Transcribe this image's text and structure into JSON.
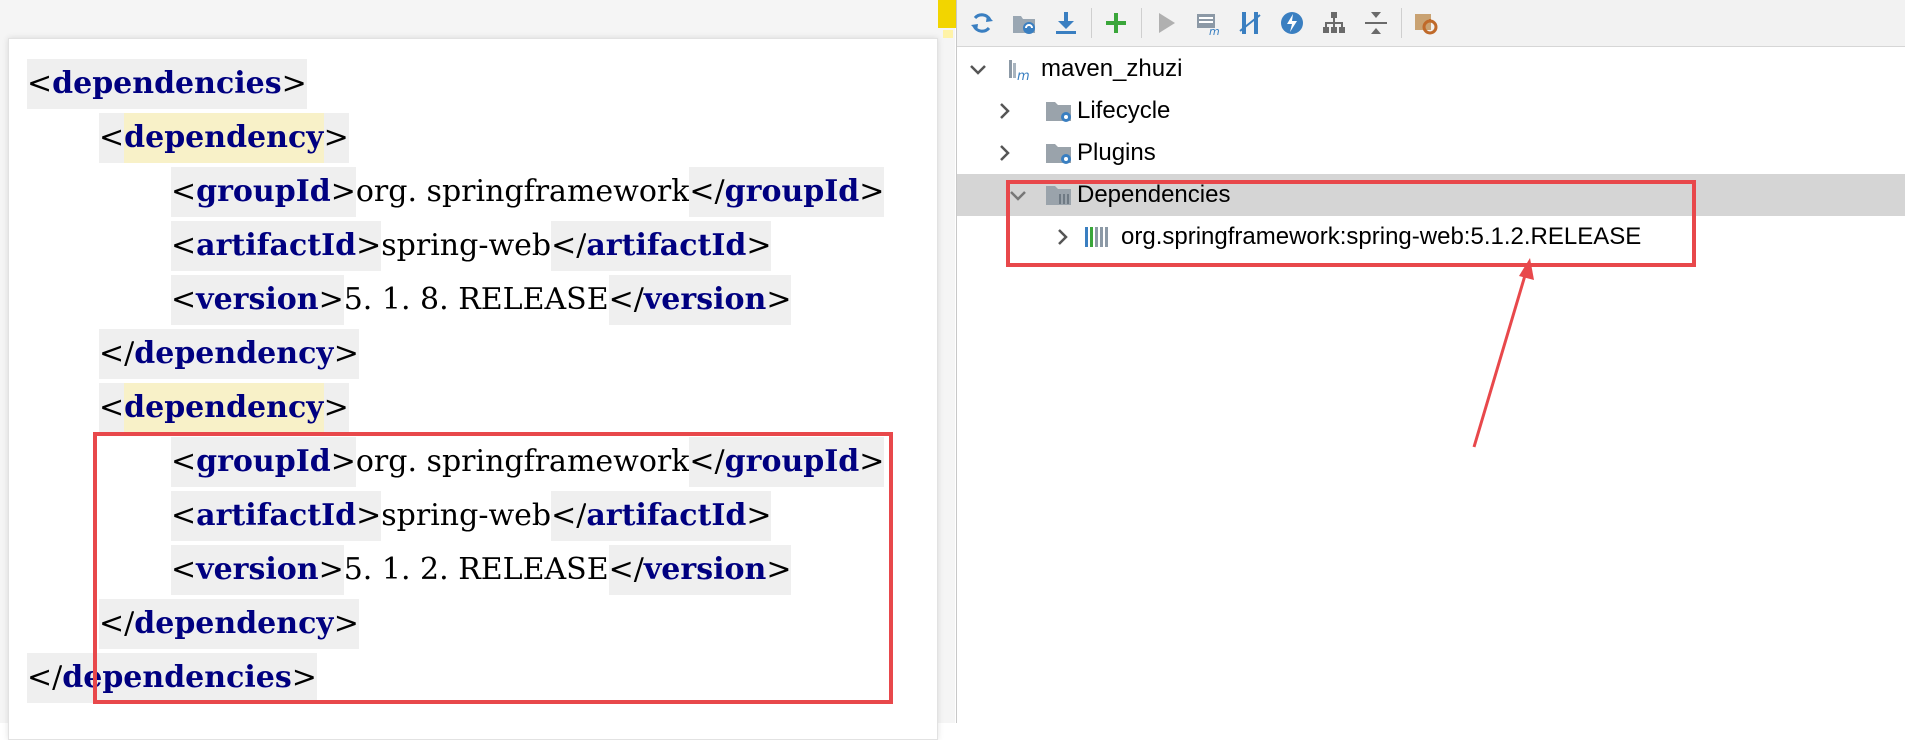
{
  "editor": {
    "lines": [
      {
        "indent": 0,
        "open": "dependencies"
      },
      {
        "indent": 1,
        "open": "dependency"
      },
      {
        "indent": 2,
        "tag": "groupId",
        "value": "org. springframework"
      },
      {
        "indent": 2,
        "tag": "artifactId",
        "value": "spring-web"
      },
      {
        "indent": 2,
        "tag": "version",
        "value": "5. 1. 8. RELEASE"
      },
      {
        "indent": 1,
        "close": "dependency"
      },
      {
        "indent": 1,
        "open": "dependency"
      },
      {
        "indent": 2,
        "tag": "groupId",
        "value": "org. springframework"
      },
      {
        "indent": 2,
        "tag": "artifactId",
        "value": "spring-web"
      },
      {
        "indent": 2,
        "tag": "version",
        "value": "5. 1. 2. RELEASE"
      },
      {
        "indent": 1,
        "close": "dependency"
      },
      {
        "indent": 0,
        "close": "dependencies"
      }
    ]
  },
  "maven": {
    "toolbar": [
      {
        "icon": "reload-icon",
        "color": "#3a7fc1"
      },
      {
        "icon": "generate-sources-icon",
        "color": "#7a8b9a"
      },
      {
        "icon": "download-icon",
        "color": "#3a7fc1"
      },
      {
        "icon": "add-icon",
        "color": "#3aa63a"
      },
      {
        "icon": "run-icon",
        "color": "#a0a0a0"
      },
      {
        "icon": "execute-goal-icon",
        "color": "#7a8b9a"
      },
      {
        "icon": "toggle-offline-icon",
        "color": "#3a7fc1"
      },
      {
        "icon": "skip-tests-icon",
        "color": "#3a7fc1"
      },
      {
        "icon": "show-dependencies-icon",
        "color": "#6a6a6a"
      },
      {
        "icon": "collapse-all-icon",
        "color": "#6a6a6a"
      },
      {
        "icon": "maven-settings-icon",
        "color": "#c06a2a"
      }
    ],
    "tree": {
      "project": "maven_zhuzi",
      "lifecycle": "Lifecycle",
      "plugins": "Plugins",
      "dependencies": "Dependencies",
      "dependency_item": "org.springframework:spring-web:5.1.2.RELEASE"
    }
  },
  "colors": {
    "tag": "#000080",
    "highlight_box": "#e8484b",
    "selection": "#d5d5d5"
  }
}
